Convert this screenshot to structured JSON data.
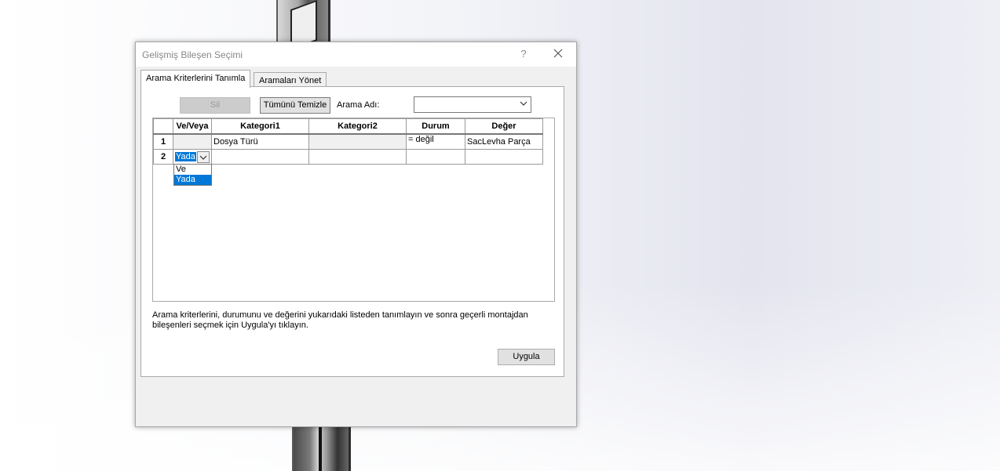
{
  "dialog": {
    "title": "Gelişmiş Bileşen Seçimi",
    "help": "?",
    "tabs": [
      {
        "label": "Arama Kriterlerini Tanımla",
        "active": true
      },
      {
        "label": "Aramaları Yönet",
        "active": false
      }
    ],
    "toolbar": {
      "delete_label": "Sil",
      "clear_all_label": "Tümünü Temizle",
      "search_name_label": "Arama Adı:",
      "search_name_value": ""
    },
    "grid": {
      "headers": [
        "Ve/Veya",
        "Kategori1",
        "Kategori2",
        "Durum",
        "Değer"
      ],
      "rows": [
        {
          "num": "1",
          "andor": "",
          "cat1": "Dosya Türü",
          "cat2": "",
          "cond": "= değil",
          "val": "SacLevha Parça"
        },
        {
          "num": "2",
          "andor": "Yada",
          "cat1": "",
          "cat2": "",
          "cond": "",
          "val": ""
        }
      ],
      "dropdown_options": [
        "Ve",
        "Yada"
      ],
      "dropdown_selected": "Yada"
    },
    "description": "Arama kriterlerini, durumunu ve değerini yukarıdaki listeden tanımlayın ve sonra geçerli montajdan bileşenleri seçmek için Uygula'yı tıklayın.",
    "apply_label": "Uygula"
  },
  "colors": {
    "selection": "#0078d7",
    "dialog_bg": "#f0f0f0"
  }
}
